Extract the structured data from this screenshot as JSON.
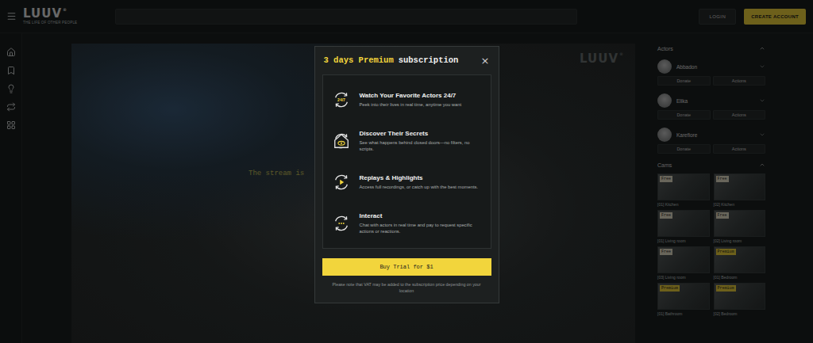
{
  "header": {
    "logo": "LUUV",
    "logo_mark": "®",
    "tagline": "THE LIFE OF OTHER PEOPLE",
    "search": {
      "placeholder": ""
    },
    "login": "LOGIN",
    "create_account": "CREATE ACCOUNT"
  },
  "stream": {
    "watermark": "LUUV",
    "watermark_mark": "®",
    "message": "The stream is"
  },
  "sidebar": {
    "actors_title": "Actors",
    "actors": [
      {
        "name": "Abbadon",
        "donate": "Donate",
        "actions": "Actions"
      },
      {
        "name": "Elika",
        "donate": "Donate",
        "actions": "Actions"
      },
      {
        "name": "Karefiore",
        "donate": "Donate",
        "actions": "Actions"
      }
    ],
    "cams_title": "Cams",
    "cams": [
      {
        "badge": "Free",
        "label": "[01] Kitchen",
        "kind": "free"
      },
      {
        "badge": "Free",
        "label": "[02] Kitchen",
        "kind": "free"
      },
      {
        "badge": "Free",
        "label": "[01] Living room",
        "kind": "free"
      },
      {
        "badge": "Free",
        "label": "[02] Living room",
        "kind": "free"
      },
      {
        "badge": "Free",
        "label": "[03] Living room",
        "kind": "free"
      },
      {
        "badge": "Premium",
        "label": "[01] Bedroom",
        "kind": "premium"
      },
      {
        "badge": "Premium",
        "label": "[01] Bathroom",
        "kind": "premium"
      },
      {
        "badge": "Premium",
        "label": "[02] Bedroom",
        "kind": "premium"
      }
    ]
  },
  "modal": {
    "title_highlight": "3 days Premium",
    "title": "subscription",
    "close": "×",
    "features": [
      {
        "kind": "clock",
        "icon_text": "24/7",
        "title": "Watch Your Favorite Actors 24/7",
        "text": "Peek into their lives in real time, anytime you want"
      },
      {
        "kind": "house",
        "icon_text": "",
        "title": "Discover Their Secrets",
        "text": "See what happens behind closed doors—no filters, no scripts."
      },
      {
        "kind": "play",
        "icon_text": "",
        "title": "Replays & Highlights",
        "text": "Access full recordings, or catch up with the best moments."
      },
      {
        "kind": "chat",
        "icon_text": "",
        "title": "Interact",
        "text": "Chat with actors in real time and pay to request specific actions or reactions."
      }
    ],
    "button": "Buy Trial for $1",
    "note": "Please note that VAT may be added to the subscription price depending on your location"
  }
}
